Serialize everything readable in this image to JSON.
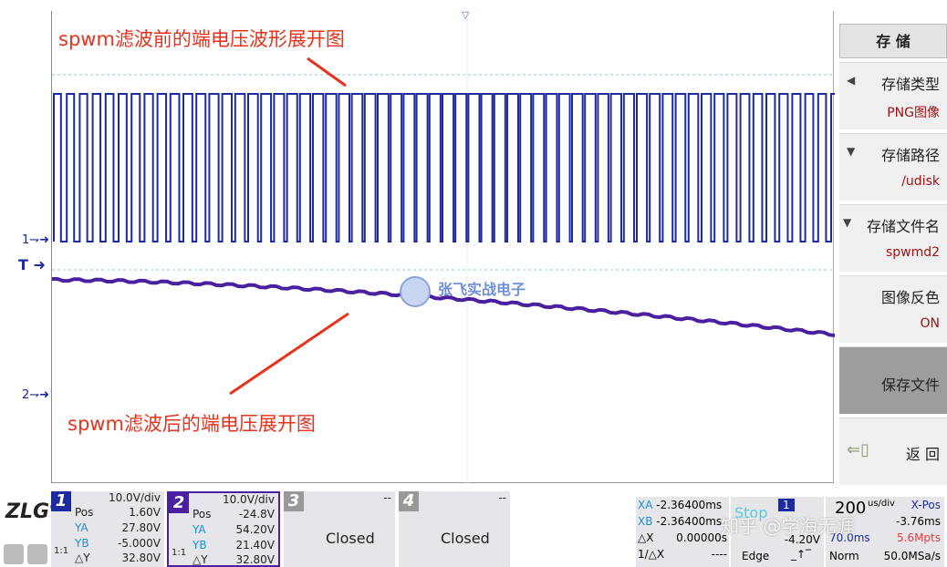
{
  "annotations": {
    "top": "spwm滤波前的端电压波形展开图",
    "bottom": "spwm滤波后的端电压展开图"
  },
  "markers": {
    "ch1": "1",
    "ch2": "2",
    "trigger": "T"
  },
  "watermark": {
    "text": "张飞实战电子",
    "credit": "知乎 @学海无涯"
  },
  "colors": {
    "ch1": "#1b2a9e",
    "ch2": "#4a1fa0",
    "annotation": "#e8321c",
    "cursor": "#7fd0e0"
  },
  "menu": {
    "title": "存 储",
    "items": [
      {
        "label": "存储类型",
        "value": "PNG图像",
        "icon": "triangle-left-icon"
      },
      {
        "label": "存储路径",
        "value": "/udisk",
        "icon": "triangle-down-icon"
      },
      {
        "label": "存储文件名",
        "value": "spwmd2",
        "icon": "triangle-down-icon"
      },
      {
        "label": "图像反色",
        "value": "ON"
      },
      {
        "label": "保存文件"
      },
      {
        "label": "返 回",
        "icon": "back-icon"
      }
    ]
  },
  "channels": [
    {
      "num": "1",
      "scale": "10.0V/div",
      "pos_label": "Pos",
      "pos": "1.60V",
      "ya": "27.80V",
      "yb": "-5.000V",
      "dy": "32.80V",
      "coupling": "1:1"
    },
    {
      "num": "2",
      "scale": "10.0V/div",
      "pos_label": "Pos",
      "pos": "-24.8V",
      "ya": "54.20V",
      "yb": "21.40V",
      "dy": "32.80V",
      "coupling": "1:1"
    },
    {
      "num": "3",
      "state": "Closed",
      "dash": "--"
    },
    {
      "num": "4",
      "state": "Closed",
      "dash": "--"
    }
  ],
  "labels": {
    "ya": "YA",
    "yb": "YB",
    "dy": "△Y",
    "xa": "XA",
    "xb": "XB",
    "dx": "△X",
    "inv": "1/△X"
  },
  "cursors": {
    "xa": "-2.36400ms",
    "xb": "-2.36400ms",
    "dx": "0.00000s",
    "inv_dx": "----"
  },
  "trigger": {
    "state": "Stop",
    "source": "1",
    "level": "-4.20V",
    "type": "Edge"
  },
  "timebase": {
    "scale": "200",
    "unit": "us/div",
    "xpos_label": "X-Pos",
    "xpos": "-3.76ms",
    "delay": "70.0ms",
    "depth": "5.6Mpts",
    "mode": "Norm",
    "rate": "50.0MSa/s"
  }
}
